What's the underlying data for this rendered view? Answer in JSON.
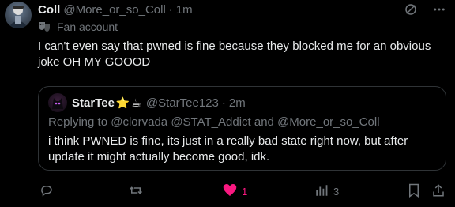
{
  "author": {
    "display_name": "Coll",
    "handle": "@More_or_so_Coll",
    "separator": "·",
    "time": "1m",
    "badge_icon": "masks-icon",
    "badge_text": "Fan account"
  },
  "tweet_text": "I can't even say that pwned is fine because they blocked me for an obvious joke OH MY GOOOD",
  "header_icons": [
    "grok-icon",
    "more-options-icon"
  ],
  "quote": {
    "display_name": "StarTee",
    "emojis": [
      "⭐",
      "☕"
    ],
    "handle": "@StarTee123",
    "separator": "·",
    "time": "2m",
    "replying_prefix": "Replying to",
    "mention_1": "@clorvada",
    "mention_2": "@STAT_Addict",
    "and_word": "and",
    "mention_3": "@More_or_so_Coll",
    "text": "i think PWNED is fine, its just in a really bad state right now, but after update it might actually become good, idk."
  },
  "actions": {
    "reply_count": "",
    "retweet_count": "",
    "like_count": "1",
    "views_count": "3"
  },
  "colors": {
    "background": "#000000",
    "text_primary": "#e7e9ea",
    "text_secondary": "#71767b",
    "border": "#2f3336",
    "like_active": "#f91880"
  }
}
